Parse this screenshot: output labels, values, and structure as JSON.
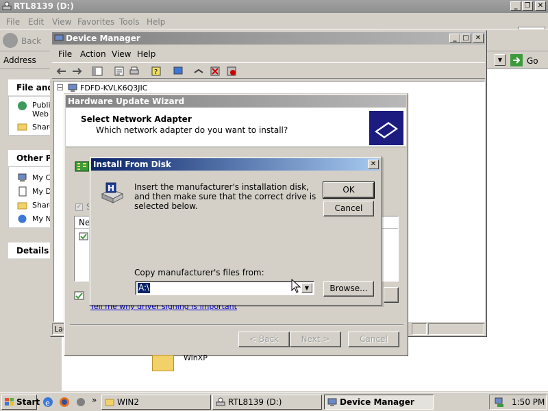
{
  "explorer": {
    "title": "RTL8139 (D:)",
    "menu": [
      "File",
      "Edit",
      "View",
      "Favorites",
      "Tools",
      "Help"
    ],
    "back_label": "Back",
    "address_label": "Address",
    "go_label": "Go",
    "tasks": {
      "file_head": "File and",
      "file_items": [
        "Publis Web",
        "Share"
      ],
      "other_head": "Other Pla",
      "other_items": [
        "My C",
        "My D",
        "Share",
        "My N"
      ],
      "details_head": "Details"
    },
    "desktop_folder_label": "WinXP"
  },
  "device_manager": {
    "title": "Device Manager",
    "menu": [
      "File",
      "Action",
      "View",
      "Help"
    ],
    "tree_root": "FDFD-KVLK6Q3JIC",
    "status_text": "Lau"
  },
  "wizard": {
    "title": "Hardware Update Wizard",
    "heading": "Select Network Adapter",
    "subheading": "Which network adapter do you want to install?",
    "list_header": "Ne",
    "link_text": "Tell me why driver signing is important",
    "back_button": "< Back",
    "next_button": "Next >",
    "cancel_button": "Cancel"
  },
  "install_from_disk": {
    "title": "Install From Disk",
    "message": "Insert the manufacturer's installation disk, and then make sure that the correct drive is selected below.",
    "ok_button": "OK",
    "cancel_button": "Cancel",
    "copy_label": "Copy manufacturer's files from:",
    "path_value": "A:\\",
    "browse_button": "Browse..."
  },
  "taskbar": {
    "start_label": "Start",
    "items": [
      "WIN2",
      "RTL8139 (D:)",
      "Device Manager"
    ],
    "active_index": 2,
    "clock": "1:50 PM"
  }
}
